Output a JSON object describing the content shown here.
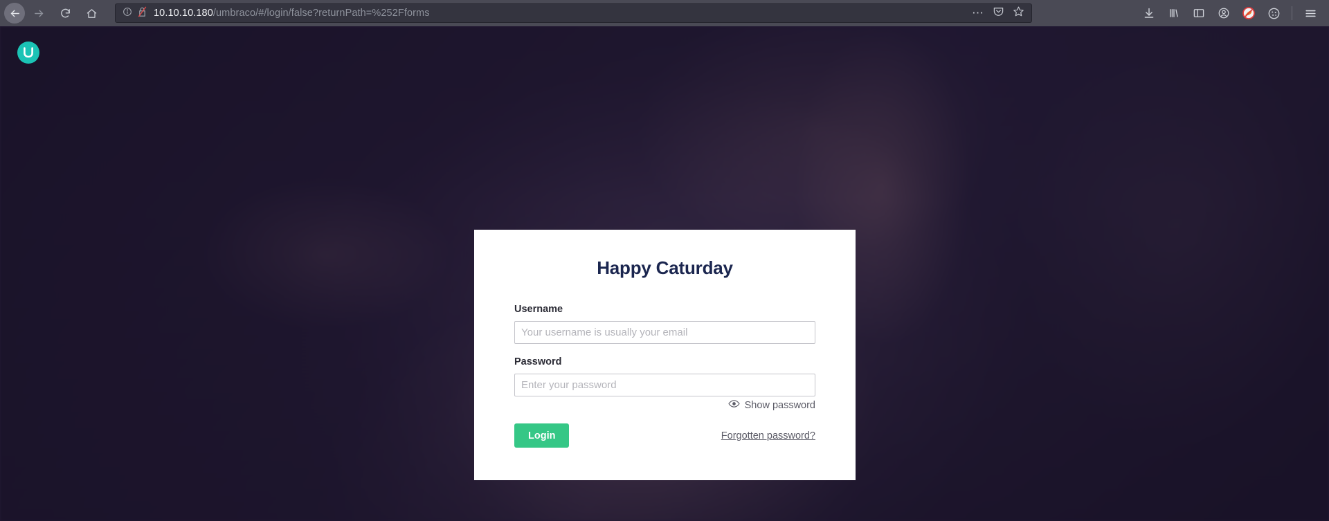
{
  "browser": {
    "nav": {
      "back_label": "Back",
      "forward_label": "Forward",
      "reload_label": "Reload",
      "home_label": "Home"
    },
    "url": {
      "host": "10.10.10.180",
      "path": "/umbraco/#/login/false?returnPath=%252Fforms",
      "full": "10.10.10.180/umbraco/#/login/false?returnPath=%252Fforms",
      "security_icon": "insecure-connection-icon",
      "info_icon": "page-info-icon"
    },
    "urlbar_actions": {
      "page_actions_label": "…",
      "pocket_label": "Save to Pocket",
      "bookmark_label": "Bookmark this page"
    },
    "toolbar_right": [
      {
        "name": "downloads-icon",
        "label": "Downloads"
      },
      {
        "name": "library-icon",
        "label": "Library"
      },
      {
        "name": "sidebar-icon",
        "label": "Sidebars"
      },
      {
        "name": "account-icon",
        "label": "Account"
      },
      {
        "name": "blocked-extension-icon",
        "label": "Blocked"
      },
      {
        "name": "cookie-icon",
        "label": "Cookies"
      },
      {
        "name": "menu-icon",
        "label": "Open application menu"
      }
    ]
  },
  "page": {
    "brand": {
      "logo_name": "umbraco-logo",
      "logo_color": "#1bc3b5",
      "logo_mark": "U"
    },
    "background": {
      "overlay_color": "#241a35",
      "accent_color": "#2b2140"
    }
  },
  "login": {
    "title": "Happy Caturday",
    "username": {
      "label": "Username",
      "placeholder": "Your username is usually your email",
      "value": ""
    },
    "password": {
      "label": "Password",
      "placeholder": "Enter your password",
      "value": ""
    },
    "show_password": {
      "label": "Show password",
      "icon": "eye-icon"
    },
    "submit_label": "Login",
    "forgot_label": "Forgotten password?",
    "accent_color": "#35c786"
  }
}
